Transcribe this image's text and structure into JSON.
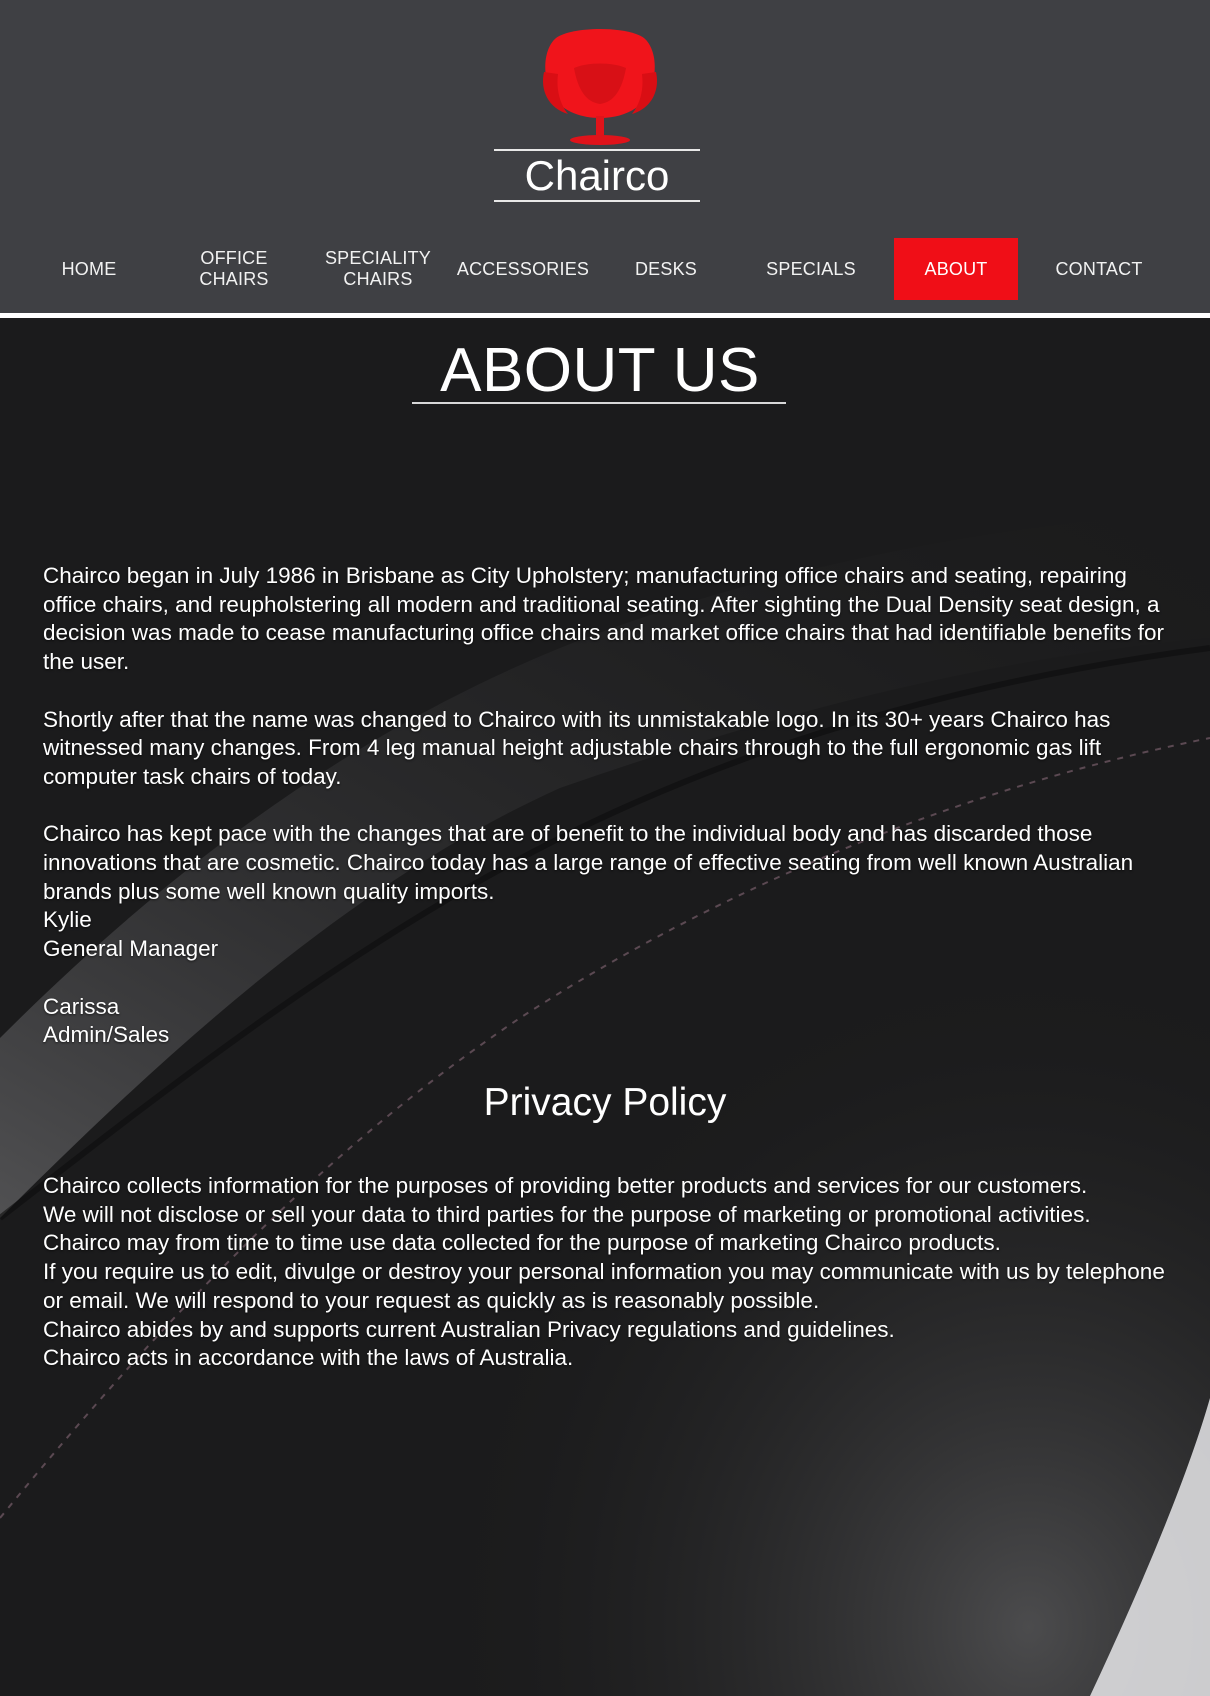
{
  "brand": {
    "name": "Chairco",
    "logo_icon": "red-swan-chair-icon",
    "accent": "#f00e17"
  },
  "nav": {
    "items": [
      {
        "label": "HOME"
      },
      {
        "label": "OFFICE\nCHAIRS"
      },
      {
        "label": "SPECIALITY\nCHAIRS"
      },
      {
        "label": "ACCESSORIES"
      },
      {
        "label": "DESKS"
      },
      {
        "label": "SPECIALS"
      },
      {
        "label": "ABOUT",
        "active": true
      },
      {
        "label": "CONTACT"
      }
    ]
  },
  "about": {
    "title": "ABOUT US",
    "paragraphs": [
      "Chairco began in July 1986 in Brisbane as City Upholstery; manufacturing office chairs and seating, repairing office chairs, and reupholstering all modern and traditional seating. After sighting the Dual Density seat design, a decision was made to cease manufacturing office chairs and market office chairs that had identifiable benefits for the user.",
      "Shortly after that the name was changed to Chairco with its unmistakable logo. In its 30+ years Chairco has witnessed many changes. From 4 leg manual height adjustable chairs through to the full ergonomic gas lift computer task chairs of today.",
      "Chairco has kept pace with the changes that are of benefit to the individual body and has discarded those innovations that are cosmetic. Chairco today has a large range of effective seating from well known Australian brands plus some well known quality imports."
    ],
    "staff": [
      {
        "name": "Kylie",
        "role": "General Manager"
      },
      {
        "name": "Carissa",
        "role": "Admin/Sales"
      }
    ]
  },
  "privacy": {
    "title": "Privacy Policy",
    "lines": [
      "Chairco  collects information for the purposes of providing better products and services for our customers.",
      "We will not disclose or sell your data to third parties for the purpose of marketing or promotional activities.",
      "Chairco may from time to time use data collected for the purpose of marketing Chairco products.",
      "If you require us to edit, divulge or destroy your personal information you may communicate with us by telephone or email.  We will respond to your request as quickly as is reasonably possible.",
      "Chairco abides by and supports current Australian Privacy regulations and guidelines.",
      "Chairco acts in accordance with the laws of Australia."
    ]
  }
}
